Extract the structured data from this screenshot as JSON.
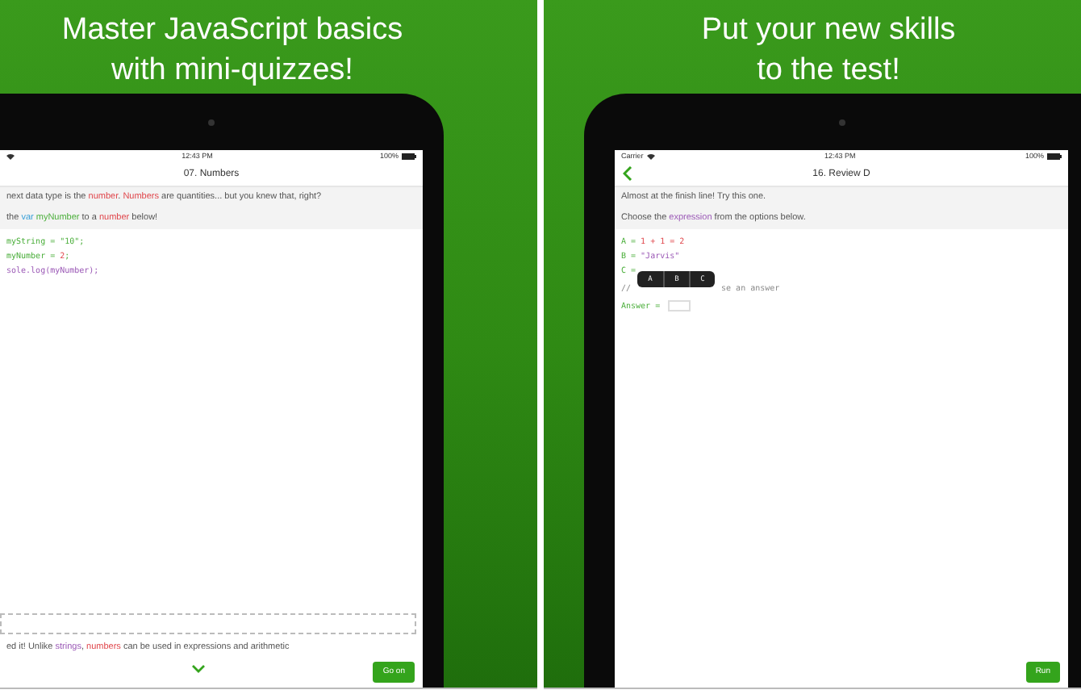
{
  "panels": [
    {
      "headline": "Master JavaScript basics\nwith mini-quizzes!",
      "screen": {
        "time": "12:43 PM",
        "battery": "100%",
        "back": false,
        "title": "07. Numbers",
        "prompts": [
          [
            {
              "text": "next data type is the ",
              "kind": "plain"
            },
            {
              "text": "number",
              "kind": "number"
            },
            {
              "text": ". ",
              "kind": "plain"
            },
            {
              "text": "Numbers",
              "kind": "number"
            },
            {
              "text": " are quantities... but you knew that, right?",
              "kind": "plain"
            }
          ],
          [
            {
              "text": "the ",
              "kind": "plain"
            },
            {
              "text": "var",
              "kind": "keyword"
            },
            {
              "text": " myNumber",
              "kind": "variable"
            },
            {
              "text": " to a ",
              "kind": "plain"
            },
            {
              "text": "number",
              "kind": "number"
            },
            {
              "text": " below!",
              "kind": "plain"
            }
          ]
        ],
        "code": [
          [
            {
              "text": "myString = \"10\";",
              "kind": "variable"
            }
          ],
          [
            {
              "text": "myNumber = ",
              "kind": "variable"
            },
            {
              "text": "2",
              "kind": "number"
            },
            {
              "text": ";",
              "kind": "variable"
            }
          ],
          [
            {
              "text": "sole.log(myNumber);",
              "kind": "string"
            }
          ]
        ],
        "answer_box": true,
        "feedback": [
          {
            "text": "ed it! Unlike ",
            "kind": "plain"
          },
          {
            "text": "strings",
            "kind": "string"
          },
          {
            "text": ", ",
            "kind": "plain"
          },
          {
            "text": "numbers",
            "kind": "number"
          },
          {
            "text": " can be used in expressions and arithmetic",
            "kind": "plain"
          }
        ],
        "more": true,
        "button": "Go on"
      }
    },
    {
      "headline": "Put your new skills\nto the test!",
      "screen": {
        "status_left": "Carrier",
        "time": "12:43 PM",
        "battery": "100%",
        "back": true,
        "title": "16. Review D",
        "prompts": [
          [
            {
              "text": "Almost at the finish line! Try this one.",
              "kind": "plain"
            }
          ],
          [
            {
              "text": "Choose the ",
              "kind": "plain"
            },
            {
              "text": "expression",
              "kind": "string"
            },
            {
              "text": " from the options below.",
              "kind": "plain"
            }
          ]
        ],
        "code": [
          [
            {
              "text": "A = ",
              "kind": "variable"
            },
            {
              "text": "1 + 1 = 2",
              "kind": "number"
            }
          ],
          [
            {
              "text": "B = ",
              "kind": "variable"
            },
            {
              "text": "\"Jarvis\"",
              "kind": "string"
            }
          ],
          [
            {
              "text": "C = ",
              "kind": "variable"
            }
          ]
        ],
        "comment": {
          "start": "//",
          "end": "se an answer"
        },
        "popover": {
          "options": [
            "A",
            "B",
            "C"
          ]
        },
        "answer_line": "Answer = ",
        "answer_box": false,
        "more": false,
        "button": "Run"
      }
    }
  ]
}
